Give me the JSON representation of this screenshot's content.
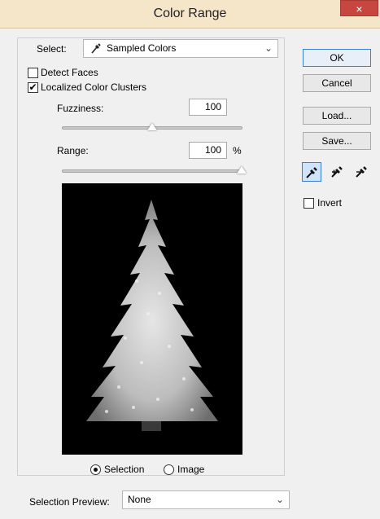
{
  "window": {
    "title": "Color Range",
    "close_glyph": "×"
  },
  "select": {
    "label": "Select:",
    "value": "Sampled Colors",
    "icon": "eyedropper-icon"
  },
  "options": {
    "detect_faces": {
      "label": "Detect Faces",
      "checked": false
    },
    "localized_color_clusters": {
      "label": "Localized Color Clusters",
      "checked": true
    }
  },
  "fuzziness": {
    "label": "Fuzziness:",
    "value": "100",
    "slider_fraction": 0.5
  },
  "range": {
    "label": "Range:",
    "value": "100",
    "unit": "%",
    "slider_fraction": 1.0
  },
  "buttons": {
    "ok": "OK",
    "cancel": "Cancel",
    "load": "Load...",
    "save": "Save..."
  },
  "eyedroppers": [
    {
      "icon": "eyedropper-icon",
      "active": true
    },
    {
      "icon": "eyedropper-plus-icon",
      "active": false
    },
    {
      "icon": "eyedropper-minus-icon",
      "active": false
    }
  ],
  "invert": {
    "label": "Invert",
    "checked": false
  },
  "preview": {
    "selection_label": "Selection",
    "image_label": "Image",
    "selected": "selection"
  },
  "selection_preview": {
    "label": "Selection Preview:",
    "value": "None"
  },
  "colors": {
    "titlebar": "#f5e6c9",
    "close_button": "#c7463f",
    "accent": "#3b7fd1"
  }
}
